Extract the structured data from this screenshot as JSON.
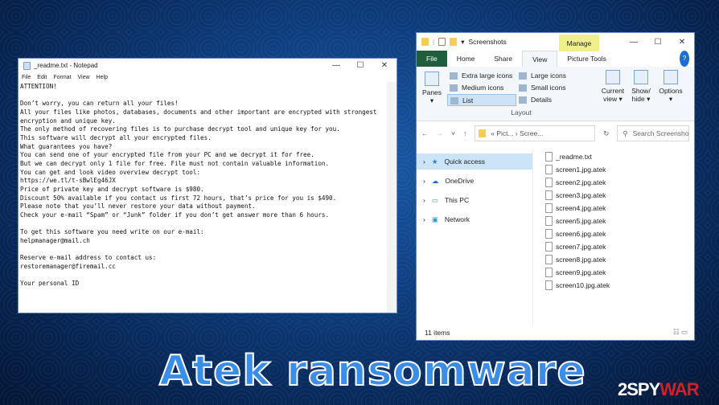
{
  "notepad": {
    "title": "_readme.txt - Notepad",
    "menu": [
      "File",
      "Edit",
      "Format",
      "View",
      "Help"
    ],
    "text": "ATTENTION!\n\nDon’t worry, you can return all your files!\nAll your files like photos, databases, documents and other important are encrypted with strongest\nencryption and unique key.\nThe only method of recovering files is to purchase decrypt tool and unique key for you.\nThis software will decrypt all your encrypted files.\nWhat guarantees you have?\nYou can send one of your encrypted file from your PC and we decrypt it for free.\nBut we can decrypt only 1 file for free. File must not contain valuable information.\nYou can get and look video overview decrypt tool:\nhttps://we.tl/t-sBwlEg46JX\nPrice of private key and decrypt software is $980.\nDiscount 50% available if you contact us first 72 hours, that’s price for you is $490.\nPlease note that you’ll never restore your data without payment.\nCheck your e-mail “Spam” or “Junk” folder if you don’t get answer more than 6 hours.\n\nTo get this software you need write on our e-mail:\nhelpmanager@mail.ch\n\nReserve e-mail address to contact us:\nrestoremanager@firemail.cc\n\nYour personal ID"
  },
  "window_controls": {
    "minimize": "—",
    "maximize": "☐",
    "close": "✕"
  },
  "explorer": {
    "title": "Screenshots",
    "manage": "Manage",
    "tabs": [
      "File",
      "Home",
      "Share",
      "View",
      "Picture Tools"
    ],
    "ribbon": {
      "panes": "Panes",
      "layout_items": [
        "Extra large icons",
        "Medium icons",
        "List"
      ],
      "layout_items2": [
        "Large icons",
        "Small icons",
        "Details"
      ],
      "layout_label": "Layout",
      "current_view": "Current view ▾",
      "show_hide": "Show/ hide ▾",
      "options": "Options"
    },
    "address": {
      "path": "« Pict... › Scree...",
      "search_placeholder": "Search Screenshots"
    },
    "nav": [
      "Quick access",
      "OneDrive",
      "This PC",
      "Network"
    ],
    "files": [
      "_readme.txt",
      "screen1.jpg.atek",
      "screen2.jpg.atek",
      "screen3.jpg.atek",
      "screen4.jpg.atek",
      "screen5.jpg.atek",
      "screen6.jpg.atek",
      "screen7.jpg.atek",
      "screen8.jpg.atek",
      "screen9.jpg.atek",
      "screen10.jpg.atek"
    ],
    "status": "11 items"
  },
  "banner": {
    "title": "Atek ransomware",
    "logo": "2SPYWAR"
  },
  "colors": {
    "accent": "#3a8ee8",
    "file_tab": "#1f5e3c",
    "manage": "#f0ef8c",
    "logo_red": "#d0202a"
  }
}
